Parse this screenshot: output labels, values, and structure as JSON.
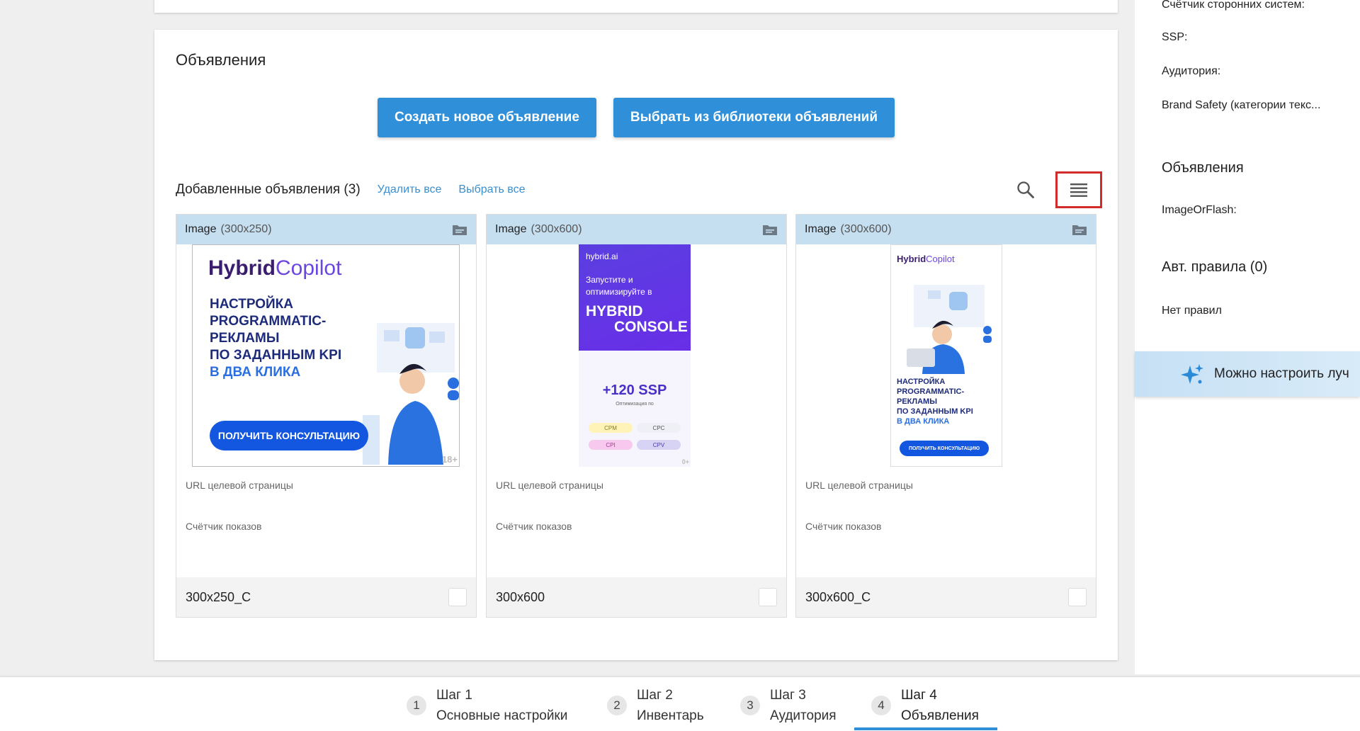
{
  "ads_section": {
    "title": "Объявления",
    "create_button": "Создать новое объявление",
    "library_button": "Выбрать из библиотеки объявлений",
    "added_title": "Добавленные объявления (3)",
    "delete_all": "Удалить все",
    "select_all": "Выбрать все"
  },
  "ads": [
    {
      "type": "Image",
      "size": "(300x250)",
      "url_label": "URL целевой страницы",
      "counter_label": "Счётчик показов",
      "name": "300x250_C"
    },
    {
      "type": "Image",
      "size": "(300x600)",
      "url_label": "URL целевой страницы",
      "counter_label": "Счётчик показов",
      "name": "300x600"
    },
    {
      "type": "Image",
      "size": "(300x600)",
      "url_label": "URL целевой страницы",
      "counter_label": "Счётчик показов",
      "name": "300x600_C"
    }
  ],
  "banner1": {
    "logo_a": "Hybrid",
    "logo_b": "Copilot",
    "line1": "НАСТРОЙКА",
    "line2": "PROGRAMMATIC-",
    "line3": "РЕКЛАМЫ",
    "line4": "ПО ЗАДАННЫМ KPI",
    "line5": "В ДВА КЛИКА",
    "button": "ПОЛУЧИТЬ КОНСУЛЬТАЦИЮ",
    "age": "18+"
  },
  "banner2": {
    "logo": "hybrid.ai",
    "sub1": "Запустите и",
    "sub2": "оптимизируйте в",
    "head1": "HYBRID",
    "head2": "CONSOLE",
    "ssp": "+120 SSP",
    "opt": "Оптимизация по",
    "pills": [
      "CPM",
      "CPC",
      "CPI",
      "CPV"
    ],
    "age": "0+"
  },
  "banner3": {
    "logo_a": "Hybrid",
    "logo_b": "Copilot",
    "line1": "НАСТРОЙКА",
    "line2": "PROGRAMMATIC-",
    "line3": "РЕКЛАМЫ",
    "line4": "ПО ЗАДАННЫМ KPI",
    "line5": "В ДВА КЛИКА",
    "button": "ПОЛУЧИТЬ КОНСУЛЬТАЦИЮ"
  },
  "right_panel": {
    "third_party_counter": "Счётчик сторонних систем:",
    "ssp": "SSP:",
    "audience": "Аудитория:",
    "brand_safety": "Brand Safety (категории текс...",
    "ads_heading": "Объявления",
    "image_or_flash": "ImageOrFlash:",
    "rules_heading": "Авт. правила (0)",
    "no_rules": "Нет правил",
    "ai_banner": "Можно настроить луч"
  },
  "steps": [
    {
      "num": "1",
      "title": "Шаг 1",
      "subtitle": "Основные настройки"
    },
    {
      "num": "2",
      "title": "Шаг 2",
      "subtitle": "Инвентарь"
    },
    {
      "num": "3",
      "title": "Шаг 3",
      "subtitle": "Аудитория"
    },
    {
      "num": "4",
      "title": "Шаг 4",
      "subtitle": "Объявления"
    }
  ],
  "colors": {
    "primary": "#2f8fd8",
    "card_header": "#c5def0",
    "highlight_border": "#d22b2b"
  }
}
